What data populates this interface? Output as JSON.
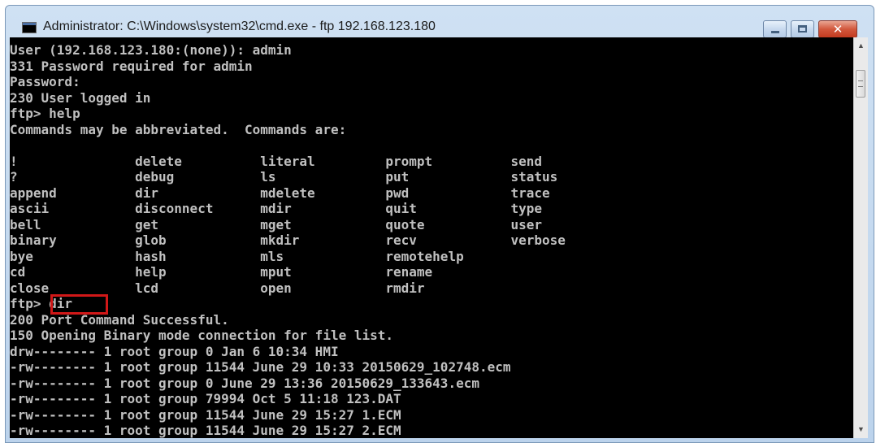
{
  "window": {
    "title": "Administrator: C:\\Windows\\system32\\cmd.exe - ftp  192.168.123.180",
    "icon": "console-icon",
    "controls": {
      "minimize": "minimize-icon",
      "maximize": "maximize-icon",
      "close": "close-icon",
      "close_glyph": "✕"
    }
  },
  "console": {
    "lines": [
      "User (192.168.123.180:(none)): admin",
      "331 Password required for admin",
      "Password:",
      "230 User logged in",
      "ftp> help",
      "Commands may be abbreviated.  Commands are:",
      "",
      "!               delete          literal         prompt          send",
      "?               debug           ls              put             status",
      "append          dir             mdelete         pwd             trace",
      "ascii           disconnect      mdir            quit            type",
      "bell            get             mget            quote           user",
      "binary          glob            mkdir           recv            verbose",
      "bye             hash            mls             remotehelp",
      "cd              help            mput            rename",
      "close           lcd             open            rmdir",
      "ftp> dir",
      "200 Port Command Successful.",
      "150 Opening Binary mode connection for file list.",
      "drw-------- 1 root group 0 Jan 6 10:34 HMI",
      "-rw-------- 1 root group 11544 June 29 10:33 20150629_102748.ecm",
      "-rw-------- 1 root group 0 June 29 13:36 20150629_133643.ecm",
      "-rw-------- 1 root group 79994 Oct 5 11:18 123.DAT",
      "-rw-------- 1 root group 11544 June 29 15:27 1.ECM",
      "-rw-------- 1 root group 11544 June 29 15:27 2.ECM"
    ],
    "highlighted_command": "dir",
    "colors": {
      "background": "#000000",
      "text": "#c0c0c0",
      "highlight_box": "#d11818"
    }
  },
  "scrollbar": {
    "up_arrow": "▲",
    "down_arrow": "▼"
  }
}
